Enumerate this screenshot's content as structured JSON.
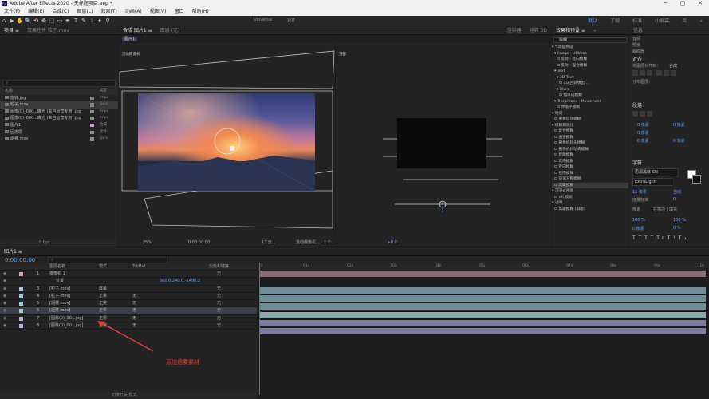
{
  "window": {
    "title": "Adobe After Effects 2020 - 无标题项目.aep *",
    "app_icon": "Ae",
    "controls": [
      "−",
      "□",
      "✕"
    ]
  },
  "menu": [
    "文件(F)",
    "编辑(E)",
    "合成(C)",
    "图层(L)",
    "效果(T)",
    "动画(A)",
    "视图(V)",
    "窗口",
    "帮助(H)"
  ],
  "workspaces": [
    "默认",
    "了解",
    "标准",
    "小屏幕",
    "库",
    "»"
  ],
  "toolbar": {
    "tools": [
      "⌂",
      "▶",
      "✋",
      "🔍",
      "⟲",
      "✥",
      "⬚",
      "▭",
      "✒",
      "T",
      "✎",
      "⊥",
      "✦",
      "⚲"
    ],
    "snapping": "Universal",
    "align": "对齐"
  },
  "project": {
    "tabs": [
      "项目 ≡",
      "效果控件 粒子.mov"
    ],
    "columns": {
      "name": "名称",
      "type": "类型"
    },
    "items": [
      {
        "name": "旋转.jpg",
        "type": "Impo",
        "swatch": "#8a8a8a"
      },
      {
        "name": "粒子.mov",
        "type": "Quic",
        "swatch": "#8a8a8a",
        "selected": true
      },
      {
        "name": "图像(0)_000...曝光 (来自运营专用).jpg",
        "type": "Impo",
        "swatch": "#8a8a8a"
      },
      {
        "name": "图像(0)_000...曝光 (来自运营专用).jpg",
        "type": "Impo",
        "swatch": "#8a8a8a"
      },
      {
        "name": "图片1",
        "type": "合成",
        "swatch": "#c9a0d0"
      },
      {
        "name": "固态层",
        "type": "文件",
        "swatch": "#8a8a8a"
      },
      {
        "name": "烟雾.mov",
        "type": "Quic",
        "swatch": "#8a8a8a"
      }
    ],
    "footer": {
      "bpc": "8 bpc"
    }
  },
  "viewer": {
    "tabs": [
      "合成 图片1 ≡",
      "图层 (无)"
    ],
    "comp_tab": "图片1",
    "renderer": "渲染器",
    "renderer_value": "经典 3D",
    "left_label": "活动摄像机",
    "right_label": "顶部",
    "footer": {
      "zoom": "25%",
      "timecode": "0:00:00:00",
      "resolution": "(二分...",
      "camera": "活动摄像机",
      "views": "2 个...",
      "exposure": "+0.0"
    }
  },
  "effects": {
    "tabs": [
      "效果和预设 ≡",
      "»"
    ],
    "search": "模糊",
    "items": [
      "▾ * 动画预设",
      "  ▾ Image - Utilities",
      "    ⊡ 反射 - 径向模糊",
      "    ⊡ 反射 - 涅合模糊",
      "  ▾ Text",
      "    ▾ 3D Text",
      "      ⊡ 3D 回转弹出…",
      "    ▾ Blurs",
      "      ⊡ 摆单词模糊",
      "  ▾ Transitions - Movement",
      "    ⊡ 伸缩平模糊",
      "▾ 时间",
      "  ⊡ 重要运动模糊",
      "▾ 模糊和锐化",
      "  ⊡ 复合模糊",
      "  ⊡ 通道模糊",
      "  ⊡ 摄像机镜头模糊",
      "  ⊡ 摄像机抖动去模糊",
      "  ⊡ 智能模糊",
      "  ⊡ 双向模糊",
      "  ⊡ 定向模糊",
      "  ⊡ 径向模糊",
      "  ⊡ 快速方框模糊",
      "  ⊡ 高斯模糊",
      "▾ 沉浸式视频",
      "  ⊡ VR 模糊",
      "▾ 过时",
      "  ⊡ 高斯模糊 (旧版)"
    ],
    "selected_index": 23
  },
  "properties": {
    "info": "信息",
    "audio": "音频",
    "preview": "预览",
    "tracker": "跟踪器",
    "align_title": "对齐",
    "align_to": "将图层对齐到：",
    "align_to_value": "合成",
    "distribute": "分布图层：",
    "paragraph": "段落",
    "para_vals": [
      "0 像素",
      "0 像素",
      "0 像素",
      "0 像素",
      "0 像素"
    ],
    "char_title": "字符",
    "font": "思源黑体 CN",
    "weight": "ExtraLight",
    "font_size": "15 像素",
    "leading": "自动",
    "kerning": "度量标准",
    "tracking": "0",
    "stroke": "像素",
    "stroke_mode": "在描边上填充",
    "vscale": "100 %",
    "hscale": "100 %",
    "baseline": "0 像素",
    "tsume": "0 %",
    "styles": [
      "T",
      "T",
      "TT",
      "Tr",
      "T¹",
      "T₁"
    ]
  },
  "timeline": {
    "tabs": [
      "图片1 ≡"
    ],
    "timecode": "0:00:00:00",
    "search": "",
    "col": {
      "name": "图层名称",
      "mode": "模式",
      "trkmat": "TrkMat",
      "parent": "父级和链接"
    },
    "layers": [
      {
        "num": "1",
        "name": "摄像机 1",
        "mode": "",
        "trk": "",
        "parent": "无",
        "color": "#d9a7b0",
        "bar": "#8a6a73"
      },
      {
        "num": "",
        "name": "位置",
        "mode": "",
        "trk": "",
        "parent": "",
        "color": "",
        "bar": "",
        "sub": true,
        "value": "360.0,240.0,-1496.2"
      },
      {
        "num": "3",
        "name": "[粒子.mov]",
        "mode": "屏幕",
        "trk": "",
        "parent": "无",
        "color": "#a2c8d4",
        "bar": "#6e8f98"
      },
      {
        "num": "4",
        "name": "[粒子.mov]",
        "mode": "正常",
        "trk": "无",
        "parent": "无",
        "color": "#a2c8d4",
        "bar": "#6e8f98"
      },
      {
        "num": "5",
        "name": "[烟雾.mov]",
        "mode": "正常",
        "trk": "无",
        "parent": "无",
        "color": "#a2c8d4",
        "bar": "#6e8f98"
      },
      {
        "num": "6",
        "name": "[烟雾.mov]",
        "mode": "正常",
        "trk": "无",
        "parent": "无",
        "color": "#a2c8d4",
        "bar": "#8aa9b0",
        "selected": true
      },
      {
        "num": "7",
        "name": "[图像(0)_00...jpg]",
        "mode": "正常",
        "trk": "无",
        "parent": "无",
        "color": "#b4b4d8",
        "bar": "#7c7c9c"
      },
      {
        "num": "8",
        "name": "[图像(0)_00...jpg]",
        "mode": "正常",
        "trk": "无",
        "parent": "无",
        "color": "#b4b4d8",
        "bar": "#7c7c9c"
      }
    ],
    "ruler": [
      "0f",
      "01s",
      "02s",
      "03s",
      "04s",
      "05s",
      "06s",
      "07s",
      "08s",
      "09s",
      "10s"
    ],
    "footer": "切换开关/模式"
  },
  "annotation": "添加烟雾素材",
  "colors": {
    "accent": "#2d7bd8",
    "annotation": "#e04030"
  }
}
